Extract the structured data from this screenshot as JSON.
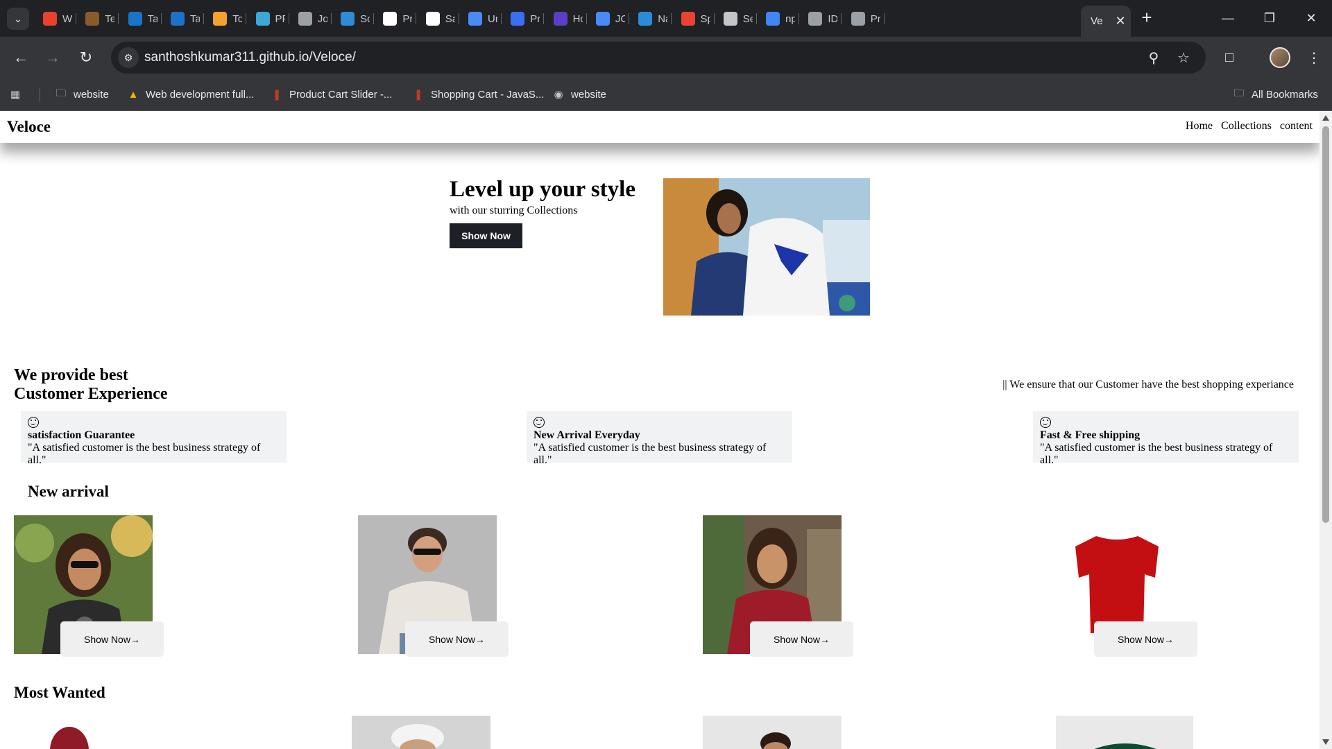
{
  "browser": {
    "tabs": [
      {
        "label": "W",
        "icon": "alert-icon",
        "color": "#e8412c"
      },
      {
        "label": "Te",
        "icon": "emblem-icon",
        "color": "#8a5a2b"
      },
      {
        "label": "Ta",
        "icon": "infosys-icon",
        "color": "#1a73c8"
      },
      {
        "label": "Ta",
        "icon": "infosys-icon",
        "color": "#1a73c8"
      },
      {
        "label": "To",
        "icon": "curve-icon",
        "color": "#f4a22d"
      },
      {
        "label": "PF",
        "icon": "swirl-icon",
        "color": "#3ba8d8"
      },
      {
        "label": "Jo",
        "icon": "globe-icon",
        "color": "#9aa0a6"
      },
      {
        "label": "Sc",
        "icon": "diamond-icon",
        "color": "#2e8bd6"
      },
      {
        "label": "Pr",
        "icon": "page-icon",
        "color": "#ffffff"
      },
      {
        "label": "Sa",
        "icon": "github-icon",
        "color": "#ffffff"
      },
      {
        "label": "Ur",
        "icon": "docs-icon",
        "color": "#4a8af4"
      },
      {
        "label": "Pr",
        "icon": "k-icon",
        "color": "#3a6ff2"
      },
      {
        "label": "Hc",
        "icon": "app-icon",
        "color": "#5a3ec8"
      },
      {
        "label": "JC",
        "icon": "docs-icon",
        "color": "#4a8af4"
      },
      {
        "label": "Na",
        "icon": "w-icon",
        "color": "#2a8cd6"
      },
      {
        "label": "Sp",
        "icon": "gmail-icon",
        "color": "#ea4335"
      },
      {
        "label": "Se",
        "icon": "gear-icon",
        "color": "#c4c7c5"
      },
      {
        "label": "np",
        "icon": "google-icon",
        "color": "#4285f4"
      },
      {
        "label": "ID",
        "icon": "globe-icon",
        "color": "#9aa0a6"
      },
      {
        "label": "Pr",
        "icon": "globe-icon",
        "color": "#9aa0a6"
      }
    ],
    "active_tab": {
      "label": "Ve"
    },
    "url": "santhoshkumar311.github.io/Veloce/",
    "bookmarks": [
      {
        "label": "website",
        "icon": "folder-icon"
      },
      {
        "label": "Web development full...",
        "icon": "drive-icon"
      },
      {
        "label": "Product Cart Slider -...",
        "icon": "bookmark-site-icon"
      },
      {
        "label": "Shopping Cart - JavaS...",
        "icon": "bookmark-site-icon"
      },
      {
        "label": "website",
        "icon": "globe-icon"
      }
    ],
    "all_bookmarks": "All Bookmarks"
  },
  "site": {
    "brand": "Veloce",
    "nav": [
      "Home",
      "Collections",
      "content"
    ],
    "hero": {
      "title": "Level up your style",
      "subtitle": "with our sturring Collections",
      "button": "Show Now"
    },
    "experience": {
      "title_line1": "We provide best",
      "title_line2": "Customer Experience",
      "note": "|| We ensure that our Customer have the best shopping experiance"
    },
    "features": [
      {
        "title": "satisfaction Guarantee",
        "quote": "\"A satisfied customer is the best business strategy of all.\""
      },
      {
        "title": "New Arrival Everyday",
        "quote": "\"A satisfied customer is the best business strategy of all.\""
      },
      {
        "title": "Fast & Free shipping",
        "quote": "\"A satisfied customer is the best business strategy of all.\""
      }
    ],
    "new_arrival": {
      "title": "New arrival",
      "button": "Show Now→"
    },
    "most_wanted": {
      "title": "Most Wanted"
    }
  },
  "colors": {
    "chrome_dark": "#202124",
    "chrome_mid": "#35363a",
    "hero_button": "#1d2026",
    "feature_bg": "#f1f2f4",
    "product_button_bg": "#efefef"
  }
}
